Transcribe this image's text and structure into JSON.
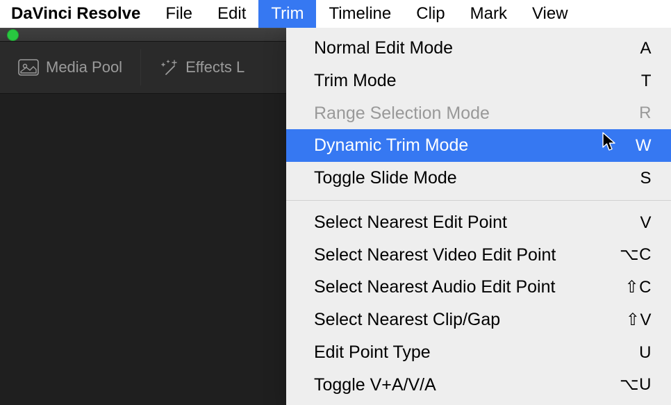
{
  "menubar": {
    "app_name": "DaVinci Resolve",
    "items": [
      "File",
      "Edit",
      "Trim",
      "Timeline",
      "Clip",
      "Mark",
      "View"
    ],
    "active_index": 2
  },
  "toolbar": {
    "media_pool_label": "Media Pool",
    "effects_label": "Effects L"
  },
  "trim_menu": {
    "groups": [
      [
        {
          "label": "Normal Edit Mode",
          "shortcut": "A",
          "disabled": false
        },
        {
          "label": "Trim Mode",
          "shortcut": "T",
          "disabled": false
        },
        {
          "label": "Range Selection Mode",
          "shortcut": "R",
          "disabled": true
        },
        {
          "label": "Dynamic Trim Mode",
          "shortcut": "W",
          "disabled": false,
          "selected": true
        },
        {
          "label": "Toggle Slide Mode",
          "shortcut": "S",
          "disabled": false
        }
      ],
      [
        {
          "label": "Select Nearest Edit Point",
          "shortcut": "V",
          "disabled": false
        },
        {
          "label": "Select Nearest Video Edit Point",
          "shortcut": "⌥C",
          "disabled": false
        },
        {
          "label": "Select Nearest Audio Edit Point",
          "shortcut": "⇧C",
          "disabled": false
        },
        {
          "label": "Select Nearest Clip/Gap",
          "shortcut": "⇧V",
          "disabled": false
        },
        {
          "label": "Edit Point Type",
          "shortcut": "U",
          "disabled": false
        },
        {
          "label": "Toggle V+A/V/A",
          "shortcut": "⌥U",
          "disabled": false
        }
      ]
    ]
  }
}
